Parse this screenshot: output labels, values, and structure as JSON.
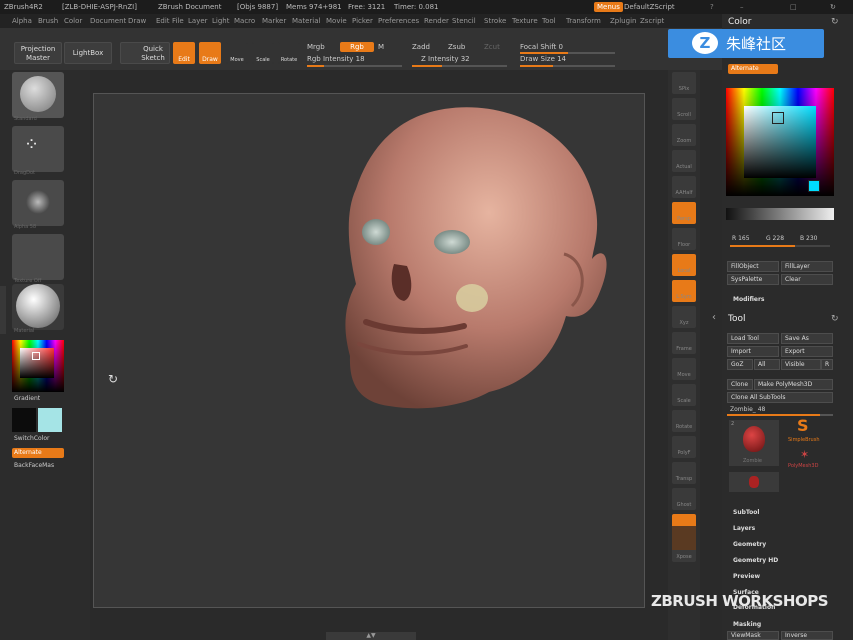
{
  "title": {
    "app": "ZBrush4R2",
    "build": "[ZLB-DHIE-ASPJ-RnZI]",
    "doc": "ZBrush Document",
    "objs": "[Objs 9887]",
    "mem": "Mems 974+981",
    "free": "Free: 3121",
    "timer": "Timer: 0.081",
    "menus_btn": "Menus",
    "script": "DefaultZScript"
  },
  "menus": [
    "Alpha",
    "Brush",
    "Color",
    "Document",
    "Draw",
    "Edit",
    "File",
    "Layer",
    "Light",
    "Macro",
    "Marker",
    "Material",
    "Movie",
    "Picker",
    "Preferences",
    "Render",
    "Stencil",
    "Stroke",
    "Texture",
    "Tool",
    "Transform",
    "Zplugin",
    "Zscript"
  ],
  "toolbar": {
    "projection": "Projection Master",
    "lightbox": "LightBox",
    "quicksketch": "Quick Sketch",
    "edit": "Edit",
    "draw": "Draw",
    "move": "Move",
    "scale": "Scale",
    "rotate": "Rotate",
    "mrgb": "Mrgb",
    "rgb": "Rgb",
    "m": "M",
    "rgb_intensity": "Rgb Intensity 18",
    "zadd": "Zadd",
    "zsub": "Zsub",
    "zcut": "Zcut",
    "z_intensity": "Z Intensity 32",
    "focal_shift": "Focal Shift 0",
    "draw_size": "Draw Size 14"
  },
  "progress": {
    "rgb_intensity": 0.18,
    "z_intensity": 0.32,
    "draw_size": 0.35
  },
  "left": {
    "brushes": [
      "Standard",
      "DragDot",
      "Alpha 58",
      "Texture Off",
      "Material"
    ],
    "gradient": "Gradient",
    "switchcolor": "SwitchColor",
    "alternate": "Alternate",
    "backfacemask": "BackFaceMas"
  },
  "right_icons": [
    "SPix",
    "Scroll",
    "Zoom",
    "Actual",
    "AAHalf",
    "Persp",
    "Floor",
    "Local",
    "L.Sym",
    "Xyz",
    "Frame",
    "Move",
    "Scale",
    "Rotate",
    "PolyF",
    "Transp",
    "Ghost",
    "Solo",
    "Xpose"
  ],
  "panel": {
    "color_title": "Color",
    "alternate": "Alternate",
    "r": "R 165",
    "g": "G 228",
    "b": "B 230",
    "fillobject": "FillObject",
    "filllayer": "FillLayer",
    "syspalette": "SysPalette",
    "clear": "Clear",
    "modifiers": "Modifiers",
    "tool_title": "Tool",
    "load_tool": "Load Tool",
    "save_as": "Save As",
    "import": "Import",
    "export": "Export",
    "goz": "GoZ",
    "all": "All",
    "visible": "Visible",
    "r_btn": "R",
    "clone": "Clone",
    "make_polymesh": "Make PolyMesh3D",
    "clone_all": "Clone All SubTools",
    "zombie": "Zombie_ 48",
    "thumb_zombie": "Zombie",
    "simplebrush": "SimpleBrush",
    "polymesh3d": "PolyMesh3D",
    "thumb_count": "2",
    "subtool": "SubTool",
    "layers": "Layers",
    "geometry": "Geometry",
    "geometry_hd": "Geometry HD",
    "preview": "Preview",
    "surface": "Surface",
    "deformation": "Deformation",
    "masking": "Masking",
    "viewmask": "ViewMask",
    "inverse": "Inverse"
  },
  "logo_text": "朱峰社区",
  "watermark": "ZBRUSH WORKSHOPS",
  "colors": {
    "accent": "#e87a18",
    "panel": "#2b2b2b",
    "logo": "#3b8de0",
    "secondary_swatch": "#a5e4e6"
  }
}
